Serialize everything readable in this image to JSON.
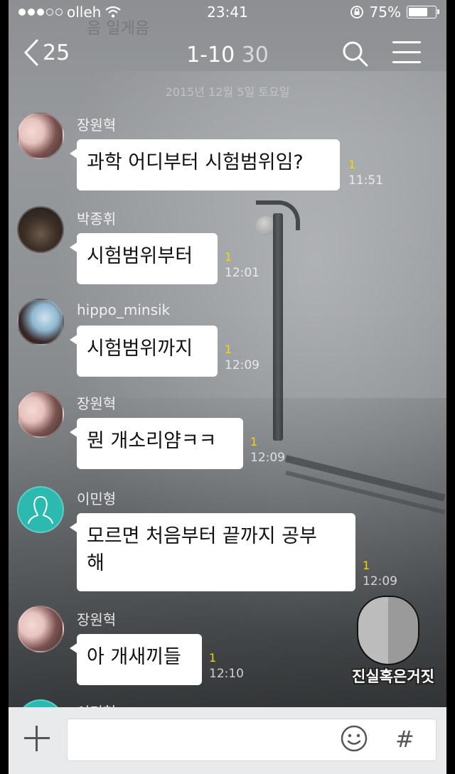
{
  "status_bar": {
    "carrier": "olleh",
    "time": "23:41",
    "battery_percent": "75%",
    "battery_level": 0.75
  },
  "header": {
    "ghost_title": "음 일게음",
    "back_count": "25",
    "title_range": "1-10",
    "title_member_count": "30",
    "date_ghost": "2015년 12월 5일 토요일"
  },
  "messages": [
    {
      "sender": "장원혁",
      "text": "과학 어디부터 시험범위임?",
      "unread": "1",
      "time": "11:51"
    },
    {
      "sender": "박종휘",
      "text": "시험범위부터",
      "unread": "1",
      "time": "12:01"
    },
    {
      "sender": "hippo_minsik",
      "text": "시험범위까지",
      "unread": "1",
      "time": "12:09"
    },
    {
      "sender": "장원혁",
      "text": "뭔 개소리얌ㅋㅋ",
      "unread": "1",
      "time": "12:09"
    },
    {
      "sender": "이민형",
      "text_line1": "모르면 처음부터 끝까지 공부",
      "text_line2": "해",
      "unread": "1",
      "time": "12:09"
    },
    {
      "sender": "장원혁",
      "text": "아 개새끼들",
      "unread": "1",
      "time": "12:10"
    },
    {
      "sender": "이민형"
    }
  ],
  "input_bar": {
    "placeholder": ""
  },
  "watermark": {
    "text": "진실혹은거짓"
  },
  "icons": {
    "back": "chevron-left-icon",
    "search": "search-icon",
    "menu": "menu-icon",
    "attach": "plus-icon",
    "emoji": "emoji-icon",
    "hashtag": "hash-icon"
  },
  "colors": {
    "unread": "#f2d21b",
    "bubble": "#ffffff",
    "input_bar": "#e9eaeb",
    "default_avatar": "#2bb9b0"
  }
}
